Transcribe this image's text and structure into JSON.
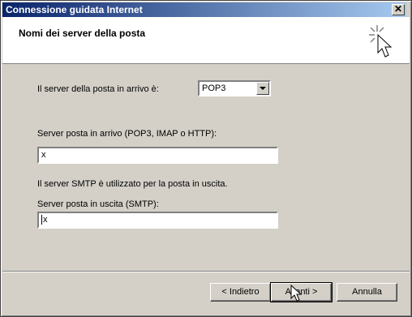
{
  "window": {
    "title": "Connessione guidata Internet",
    "close_glyph": "✕"
  },
  "header": {
    "title": "Nomi dei server della posta",
    "icon": "wizard-sparkle-icon"
  },
  "incoming_type": {
    "label": "Il server della posta in arrivo è:",
    "value": "POP3"
  },
  "incoming_server": {
    "label": "Server posta in arrivo (POP3, IMAP o HTTP):",
    "value": "x"
  },
  "smtp_info": "Il server SMTP è utilizzato per la posta in uscita.",
  "outgoing_server": {
    "label": "Server posta in uscita (SMTP):",
    "value": "x"
  },
  "buttons": {
    "back": "< Indietro",
    "next": "Avanti >",
    "cancel": "Annulla"
  }
}
